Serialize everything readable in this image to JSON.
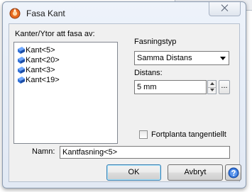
{
  "window": {
    "title": "Fasa Kant"
  },
  "edges": {
    "label": "Kanter/Ytor att fasa av:",
    "items": [
      "Kant<5>",
      "Kant<20>",
      "Kant<3>",
      "Kant<19>"
    ]
  },
  "chamfer_type": {
    "label": "Fasningstyp",
    "value": "Samma Distans"
  },
  "distance": {
    "label": "Distans:",
    "value": "5 mm",
    "more_label": "..."
  },
  "propagate": {
    "label": "Fortplanta tangentiellt",
    "checked": false
  },
  "name": {
    "label": "Namn:",
    "value": "Kantfasning<5>"
  },
  "buttons": {
    "ok": "OK",
    "cancel": "Avbryt"
  },
  "close_symbol": "⨉",
  "colors": {
    "accent": "#2f6fd6",
    "icon_orange": "#e86a1f"
  }
}
